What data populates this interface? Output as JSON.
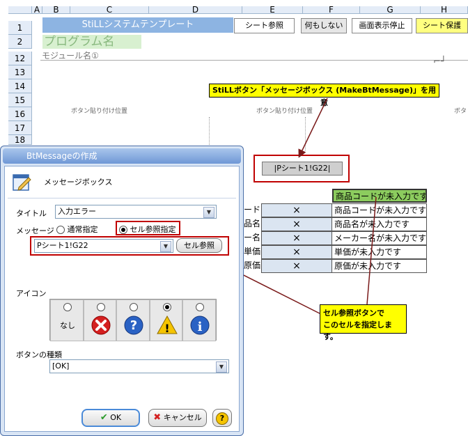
{
  "columns": [
    "A",
    "B",
    "C",
    "D",
    "E",
    "F",
    "G",
    "H"
  ],
  "rows": [
    "1",
    "2",
    "12",
    "13",
    "14",
    "15",
    "16",
    "17",
    "18"
  ],
  "sheet": {
    "title_banner": "StiLLシステムテンプレート",
    "program_name": "プログラム名",
    "module_name": "モジュール名①",
    "buttons": [
      "シート参照",
      "何もしない",
      "画面表示停止",
      "シート保護"
    ],
    "paste_position_1": "ボタン貼り付け位置",
    "paste_position_2": "ボタン貼り付け位置",
    "paste_position_3": "ボタ",
    "ref_button": "|Pシート1!G22|",
    "header_cell": "商品コードが未入力です",
    "table_rows": [
      {
        "label": "ード",
        "mark": "×",
        "message": "商品コードが未入力です"
      },
      {
        "label": "品名",
        "mark": "×",
        "message": "商品名が未入力です"
      },
      {
        "label": "ー名",
        "mark": "×",
        "message": "メーカー名が未入力です"
      },
      {
        "label": "単価",
        "mark": "×",
        "message": "単価が未入力です"
      },
      {
        "label": "原価",
        "mark": "×",
        "message": "原価が未入力です"
      }
    ]
  },
  "callouts": {
    "top": "StiLLボタン「メッセージボックス (MakeBtMessage)」を用意",
    "bottom_line1": "セル参照ボタンで",
    "bottom_line2": "このセルを指定します。"
  },
  "dialog": {
    "title": "BtMessageの作成",
    "heading": "メッセージボックス",
    "title_label": "タイトル",
    "title_value": "入力エラー",
    "message_label": "メッセージ",
    "radio_normal": "通常指定",
    "radio_cellref": "セル参照指定",
    "cellref_value": "Pシート1!G22",
    "cellref_button": "セル参照",
    "icon_label": "アイコン",
    "icon_none": "なし",
    "icon_names": [
      "none",
      "error-icon",
      "question-icon",
      "warning-icon",
      "info-icon"
    ],
    "icon_selected_index": 3,
    "button_type_label": "ボタンの種類",
    "button_type_value": "[OK]",
    "ok_label": "OK",
    "cancel_label": "キャンセル",
    "help_label": "?"
  }
}
